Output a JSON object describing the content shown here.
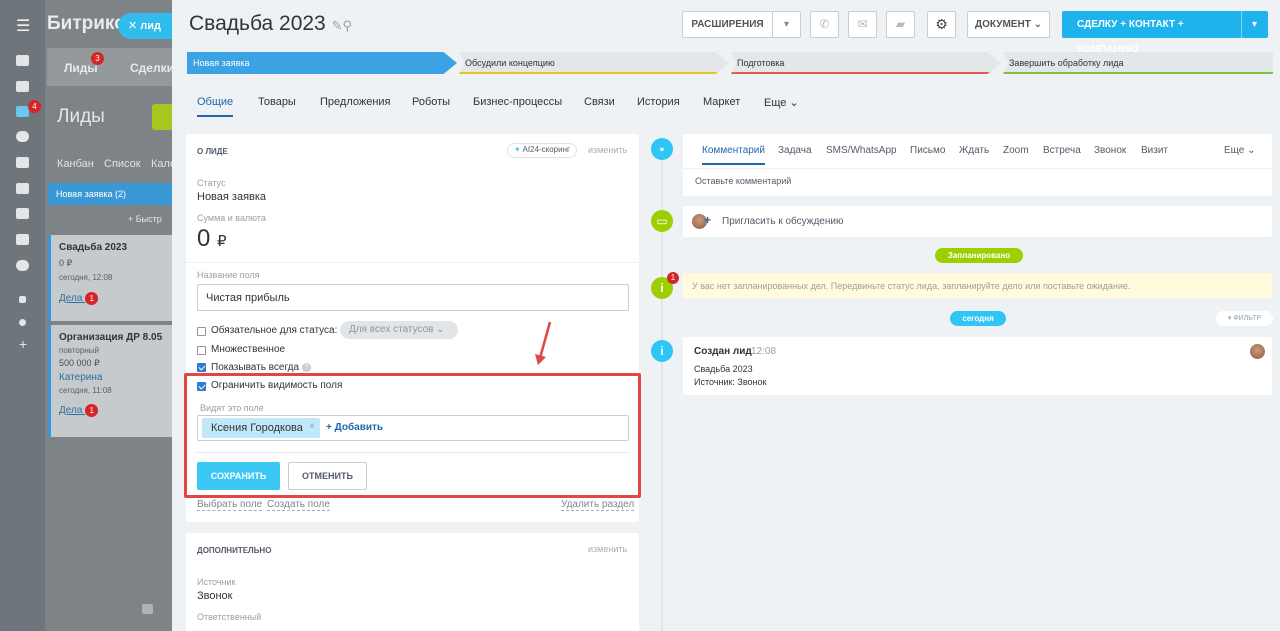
{
  "background_app": {
    "title": "Битрикс",
    "chip_label": "лид",
    "tabs": [
      {
        "label": "Лиды",
        "badge": "3"
      },
      {
        "label": "Сделки"
      }
    ],
    "sidebar_badge": "4",
    "section_title": "Лиды",
    "views": [
      "Канбан",
      "Список",
      "Календ"
    ],
    "column_title": "Новая заявка (2)",
    "quick_add": "+ Быстр",
    "cards": [
      {
        "title": "Свадьба 2023",
        "money": "0 ₽",
        "contact": "",
        "date": "сегодня, 12:08",
        "deals_label": "Дела",
        "deals_count": "1"
      },
      {
        "title": "Организация ДР 8.05",
        "meta": "повторный",
        "money": "500 000 ₽",
        "contact": "Катерина",
        "date": "сегодня, 11:08",
        "deals_label": "Дела",
        "deals_count": "1"
      }
    ]
  },
  "header": {
    "title": "Свадьба 2023",
    "extensions_label": "РАСШИРЕНИЯ",
    "document_label": "ДОКУМЕНТ",
    "create_label": "СДЕЛКУ + КОНТАКТ + КОМПАНИЮ"
  },
  "stages": [
    {
      "label": "Новая заявка",
      "color": "#3ba3e3"
    },
    {
      "label": "Обсудили концепцию",
      "color": "#e8c51a"
    },
    {
      "label": "Подготовка",
      "color": "#e95a4e"
    },
    {
      "label": "Завершить обработку лида",
      "color": "#7bc241"
    }
  ],
  "tabs": [
    "Общие",
    "Товары",
    "Предложения",
    "Роботы",
    "Бизнес-процессы",
    "Связи",
    "История",
    "Маркет",
    "Еще"
  ],
  "about": {
    "heading": "О ЛИДЕ",
    "scoring_label": "AI24-скоринг",
    "edit_link": "изменить",
    "status_label": "Статус",
    "status_value": "Новая заявка",
    "amount_label": "Сумма и валюта",
    "amount_value": "0",
    "currency": "₽",
    "field_name_label": "Название поля",
    "field_name_value": "Чистая прибыль",
    "required_label": "Обязательное для статуса:",
    "required_select": "Для всех статусов",
    "multiple_label": "Множественное",
    "show_always_label": "Показывать всегда",
    "restrict_label": "Ограничить видимость поля",
    "visible_to_label": "Видят это поле",
    "user_tag": "Ксения Городкова",
    "add_label": "+ Добавить",
    "save_label": "СОХРАНИТЬ",
    "cancel_label": "ОТМЕНИТЬ",
    "select_field": "Выбрать поле",
    "create_field": "Создать поле",
    "delete_section": "Удалить раздел"
  },
  "additional": {
    "heading": "ДОПОЛНИТЕЛЬНО",
    "edit_link": "изменить",
    "source_label": "Источник",
    "source_value": "Звонок",
    "responsible_label": "Ответственный"
  },
  "timeline": {
    "tabs": [
      "Комментарий",
      "Задача",
      "SMS/WhatsApp",
      "Письмо",
      "Ждать",
      "Zoom",
      "Встреча",
      "Звонок",
      "Визит"
    ],
    "more_label": "Еще",
    "comment_placeholder": "Оставьте комментарий",
    "invite_label": "Пригласить к обсуждению",
    "planned_label": "Запланировано",
    "warning_badge": "1",
    "no_activities_text": "У вас нет запланированных дел. Передвиньте статус лида, запланируйте дело или поставьте ожидание.",
    "today_label": "сегодня",
    "filter_label": "ФИЛЬТР",
    "event_title": "Создан лид",
    "event_time": "12:08",
    "event_name": "Свадьба 2023",
    "event_source": "Источник: Звонок"
  }
}
